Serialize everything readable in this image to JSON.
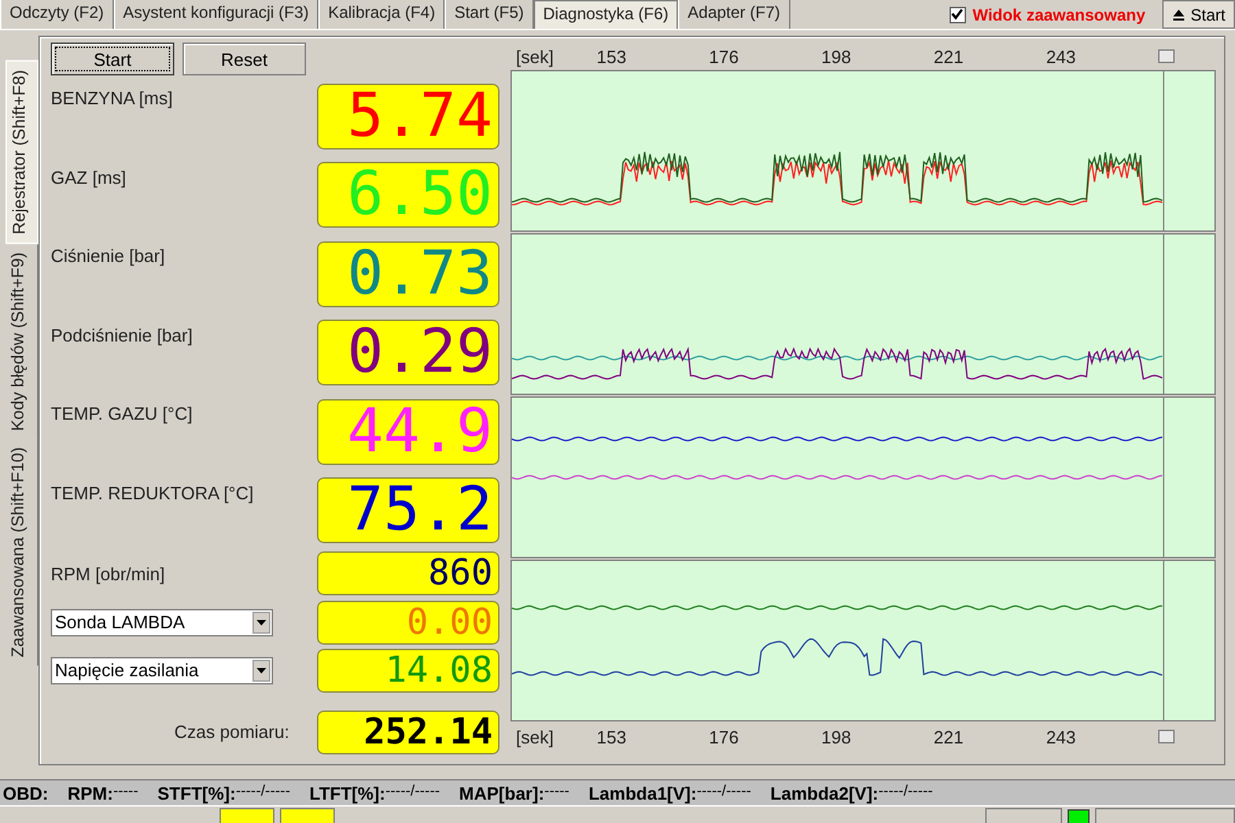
{
  "top_tabs": [
    {
      "label": "Odczyty (F2)",
      "selected": false
    },
    {
      "label": "Asystent konfiguracji (F3)",
      "selected": false
    },
    {
      "label": "Kalibracja (F4)",
      "selected": false
    },
    {
      "label": "Start (F5)",
      "selected": false
    },
    {
      "label": "Diagnostyka (F6)",
      "selected": true
    },
    {
      "label": "Adapter (F7)",
      "selected": false
    }
  ],
  "advanced_view": {
    "label": "Widok zaawansowany",
    "checked": true
  },
  "start_top_button": {
    "label": "Start"
  },
  "side_tabs": [
    {
      "label": "Rejestrator (Shift+F8)",
      "selected": true
    },
    {
      "label": "Kody błędów (Shift+F9)",
      "selected": false
    },
    {
      "label": "Zaawansowana (Shift+F10)",
      "selected": false
    }
  ],
  "buttons": [
    {
      "label": "Start",
      "selected": true
    },
    {
      "label": "Reset",
      "selected": false
    }
  ],
  "readings": [
    {
      "kind": "big",
      "label": "BENZYNA [ms]",
      "value": "5.74",
      "color": "#ff0000"
    },
    {
      "kind": "big",
      "label": "GAZ [ms]",
      "value": "6.50",
      "color": "#22ee22"
    },
    {
      "kind": "big",
      "label": "Ciśnienie [bar]",
      "value": "0.73",
      "color": "#118888"
    },
    {
      "kind": "big",
      "label": "Podciśnienie [bar]",
      "value": "0.29",
      "color": "#800080"
    },
    {
      "kind": "big",
      "label": "TEMP. GAZU [°C]",
      "value": "44.9",
      "color": "#ff22ff"
    },
    {
      "kind": "big",
      "label": "TEMP. REDUKTORA [°C]",
      "value": "75.2",
      "color": "#0000cc"
    },
    {
      "kind": "small",
      "label": "RPM [obr/min]",
      "value": "860",
      "color": "#000066"
    },
    {
      "kind": "select",
      "label": "Sonda LAMBDA",
      "value": "0.00",
      "color": "#ee7700"
    },
    {
      "kind": "select",
      "label": "Napięcie zasilania",
      "value": "14.08",
      "color": "#119911"
    }
  ],
  "measure_time": {
    "label": "Czas pomiaru:",
    "value": "252.14"
  },
  "top_axis": {
    "unit": "[sek]",
    "ticks": [
      "153",
      "176",
      "198",
      "221",
      "243"
    ]
  },
  "bottom_axis": {
    "unit": "[sek]",
    "ticks": [
      "153",
      "176",
      "198",
      "221",
      "243"
    ]
  },
  "obd_bar": {
    "title": "OBD:",
    "items": [
      {
        "label": "RPM:",
        "value": "-----"
      },
      {
        "label": "STFT[%]:",
        "value": "-----/-----"
      },
      {
        "label": "LTFT[%]:",
        "value": "-----/-----"
      },
      {
        "label": "MAP[bar]:",
        "value": "-----"
      },
      {
        "label": "Lambda1[V]:",
        "value": "-----/-----"
      },
      {
        "label": "Lambda2[V]:",
        "value": "-----/-----"
      }
    ]
  }
}
